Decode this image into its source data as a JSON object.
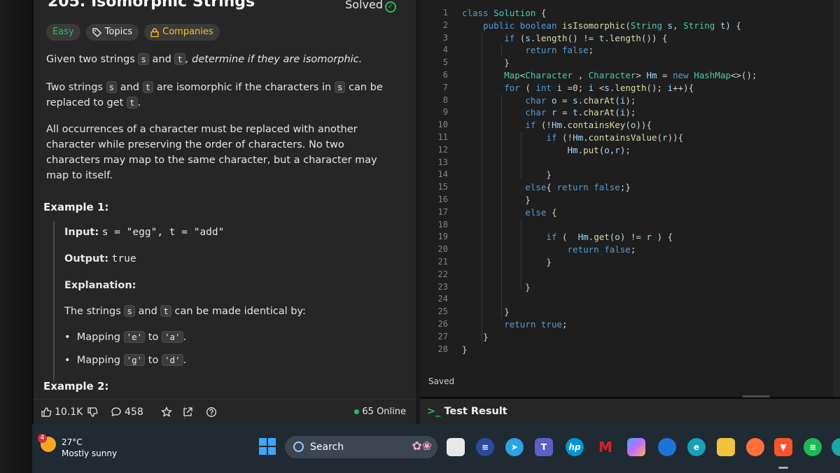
{
  "problem": {
    "title": "205. Isomorphic Strings",
    "solved": "Solved",
    "tags": {
      "easy": "Easy",
      "topics": "Topics",
      "companies": "Companies"
    },
    "p1": {
      "a": "Given two strings ",
      "s": "s",
      "b": " and ",
      "t": "t",
      "c": ", determine if they are isomorphic."
    },
    "p2": {
      "a": "Two strings ",
      "s": "s",
      "b": " and ",
      "t": "t",
      "c": " are isomorphic if the characters in ",
      "s2": "s",
      "d": " can be replaced to get ",
      "t2": "t",
      "e": "."
    },
    "p3": "All occurrences of a character must be replaced with another character while preserving the order of characters. No two characters may map to the same character, but a character may map to itself.",
    "example1": {
      "title": "Example 1:",
      "input_label": "Input:",
      "input_value": "s = \"egg\", t = \"add\"",
      "output_label": "Output:",
      "output_value": "true",
      "explanation_label": "Explanation:",
      "explanation": {
        "a": "The strings ",
        "s": "s",
        "b": " and ",
        "t": "t",
        "c": " can be made identical by:"
      },
      "bullets": [
        {
          "a": "Mapping ",
          "from": "'e'",
          "b": " to ",
          "to": "'a'",
          "c": "."
        },
        {
          "a": "Mapping ",
          "from": "'g'",
          "b": " to ",
          "to": "'d'",
          "c": "."
        }
      ]
    },
    "example2_title": "Example 2:",
    "bar": {
      "likes": "10.1K",
      "comments": "458",
      "online": "65 Online"
    }
  },
  "editor": {
    "line_numbers": [
      "1",
      "2",
      "3",
      "4",
      "5",
      "6",
      "7",
      "8",
      "9",
      "10",
      "11",
      "12",
      "13",
      "14",
      "15",
      "16",
      "17",
      "18",
      "19",
      "20",
      "21",
      "22",
      "23",
      "24",
      "25",
      "26",
      "27",
      "28"
    ],
    "code": [
      "class Solution {",
      "    public boolean isIsomorphic(String s, String t) {",
      "        if (s.length() != t.length()) {",
      "            return false;",
      "        }",
      "        Map<Character , Character> Hm = new HashMap<>();",
      "        for ( int i =0; i <s.length(); i++){",
      "            char o = s.charAt(i);",
      "            char r = t.charAt(i);",
      "            if (!Hm.containsKey(o)){",
      "                if (!Hm.containsValue(r)){",
      "                    Hm.put(o,r);",
      "",
      "                }",
      "            else{ return false;}",
      "            }",
      "            else {",
      "",
      "                if (  Hm.get(o) != r ) {",
      "                    return false;",
      "                }",
      "",
      "            }",
      "",
      "        }",
      "        return true;",
      "    }",
      "}"
    ],
    "status": "Saved",
    "test_result": "Test Result"
  },
  "taskbar": {
    "weather_badge": "4",
    "temp": "27°C",
    "condition": "Mostly sunny",
    "search": "Search",
    "apps": [
      "file-explorer",
      "edge-dark",
      "telegram",
      "teams",
      "hp",
      "mcafee",
      "copilot",
      "chrome-canary",
      "edge",
      "folder",
      "firefox",
      "brave",
      "spotify",
      "edge-beta"
    ]
  }
}
